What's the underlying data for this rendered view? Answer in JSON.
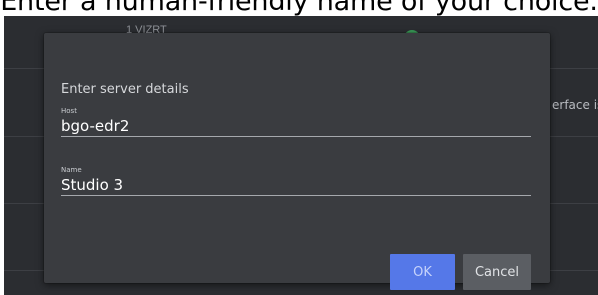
{
  "caption": "Enter a human-friendly name of your choice.",
  "background": {
    "row_text": "1 VIZRT",
    "side_text": "erface is"
  },
  "dialog": {
    "title": "Enter server details",
    "host": {
      "label": "Host",
      "value": "bgo-edr2"
    },
    "name": {
      "label": "Name",
      "value": "Studio 3"
    },
    "ok_label": "OK",
    "cancel_label": "Cancel"
  },
  "colors": {
    "accent": "#5578e8",
    "dialog_background": "#3a3c40",
    "app_background": "#2b2d31",
    "status_online": "#3a9a58"
  }
}
